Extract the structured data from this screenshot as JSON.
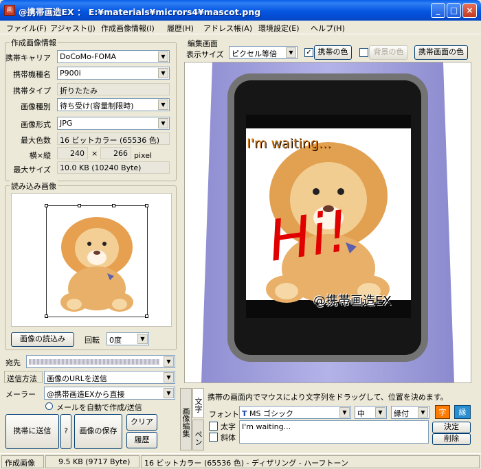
{
  "window": {
    "title": "@携帯画造EX ： E:¥materials¥micrors4¥mascot.png",
    "icon_text": "画",
    "controls": {
      "minimize": "_",
      "maximize": "□",
      "close": "×"
    }
  },
  "menu": [
    "ファイル(F)",
    "アジャスト(J)",
    "作成画像情報(I)",
    "履歴(H)",
    "アドレス帳(A)",
    "環境設定(E)",
    "ヘルプ(H)"
  ],
  "image_info": {
    "title": "作成画像情報",
    "carrier_label": "携帯キャリア",
    "carrier": "DoCoMo-FOMA",
    "model_label": "携帯機種名",
    "model": "P900i",
    "type_label": "携帯タイプ",
    "type": "折りたたみ",
    "kind_label": "画像種別",
    "kind": "待ち受け(容量制限時)",
    "format_label": "画像形式",
    "format": "JPG",
    "colors_label": "最大色数",
    "colors": "16 ビットカラー (65536 色)",
    "size_label": "横×縦",
    "width": "240",
    "times": "×",
    "height": "266",
    "unit": "pixel",
    "maxsize_label": "最大サイズ",
    "maxsize": "10.0 KB (10240 Byte)"
  },
  "loaded_image": {
    "title": "読み込み画像",
    "load_button": "画像の読込み",
    "rotate_label": "回転",
    "rotate_value": "0度"
  },
  "send": {
    "to_label": "宛先",
    "to_value": "",
    "method_label": "送信方法",
    "method_value": "画像のURLを送信",
    "mailer_label": "メーラー",
    "mailer_value": "@携帯画造EXから直接",
    "auto_label": "メールを自動で作成/送信"
  },
  "actions": {
    "send_button": "携帯に送信",
    "help_button": "?",
    "save_button": "画像の保存",
    "clear_button": "クリア",
    "history_button": "履歴"
  },
  "editor": {
    "title": "編集画面",
    "display_size_label": "表示サイズ",
    "display_size_value": "ピクセル等倍",
    "phone_color_label": "携帯の色",
    "phone_color_checked": true,
    "bg_color_label": "背景の色",
    "bg_color_checked": false,
    "screen_color_button": "携帯画面の色",
    "overlay_top": "I'm waiting...",
    "overlay_hi": "Hi!",
    "overlay_bottom": "@携帯画造EX"
  },
  "text_tool": {
    "tab_edit": "画像編集",
    "tab_text": "文字",
    "tab_pen": "ペン",
    "hint": "携帯の画面内でマウスにより文字列をドラッグして、位置を決めます。",
    "font_label": "フォント",
    "font_value": "MS ゴシック",
    "size_value": "中",
    "border_value": "縁付",
    "char_color_button": "字",
    "edge_color_button": "縁",
    "bold_label": "太字",
    "italic_label": "斜体",
    "text_value": "I'm waiting...",
    "ok_button": "決定",
    "delete_button": "削除"
  },
  "status": {
    "label": "作成画像",
    "size": "9.5 KB (9717 Byte)",
    "format": "16 ビットカラー (65536 色) - ディザリング - ハーフトーン"
  },
  "colors": {
    "titlebar": "#0a5ee6",
    "phone_body": "#a4a3dc",
    "char_color": "#ff7a00",
    "edge_color": "#2a8fd0",
    "hi_text": "#e00000",
    "waiting_text": "#d07a1a"
  }
}
